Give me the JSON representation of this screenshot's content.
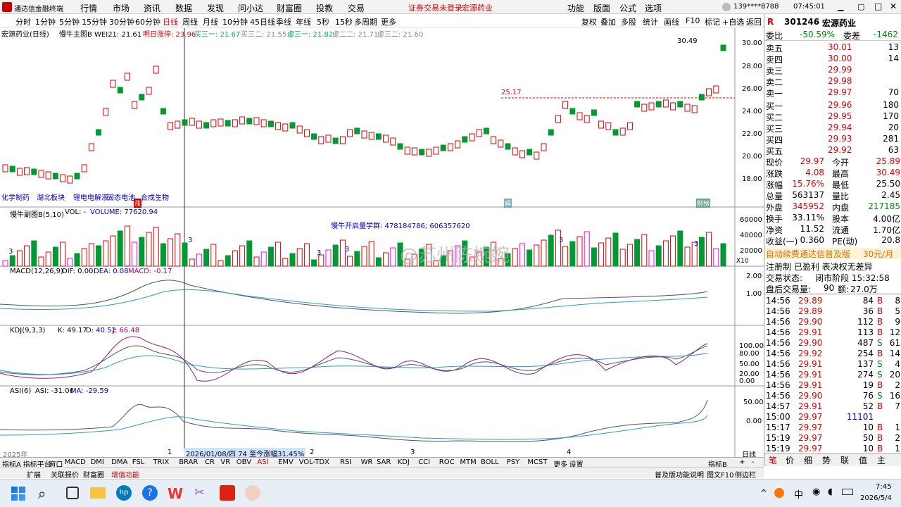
{
  "window": {
    "app_title": "通达信金融终端",
    "menus": [
      "行情",
      "市场",
      "资讯",
      "数据",
      "发现",
      "问小达",
      "财富圈",
      "投教",
      "交易"
    ],
    "notice": "证券交易未登录",
    "stock_name": "宏源药业",
    "right_menus": [
      "功能",
      "版面",
      "公式",
      "选项"
    ],
    "phone": "139****8788",
    "clock": "07:45:01"
  },
  "toolbar": {
    "periods": [
      "分时",
      "1分钟",
      "5分钟",
      "15分钟",
      "30分钟",
      "60分钟",
      "日线",
      "周线",
      "月线",
      "10分钟",
      "45日线",
      "季线",
      "年线",
      "5秒",
      "15秒",
      "多周期",
      "更多"
    ],
    "active_period": "日线",
    "tools": [
      "复权",
      "叠加",
      "多股",
      "统计",
      "画线",
      "F10",
      "标记",
      "+自选",
      "返回"
    ]
  },
  "main_chart": {
    "header_name": "宏源药业(日线)",
    "header_indicator": "慢牛主图B WEI21: 21.61",
    "header_tomorrow": "明日涨停: 23.96",
    "header_buy3": "买三一: 21.67",
    "header_sell3": "买三二: 21.55",
    "header_virt": "虚三一: 21.82",
    "header_virt2": "虚二二: 21.71",
    "header_virt3": "虚三二: 21.60",
    "high_label": "30.49",
    "dash_label": "25.17",
    "yticks": [
      "30.00",
      "28.00",
      "26.00",
      "24.00",
      "22.00",
      "20.00",
      "18.00"
    ],
    "concepts": [
      "化学制药",
      "湖北板块",
      "锂电电解液",
      "固态电池",
      "合成生物"
    ],
    "marker_dots": [
      "涨",
      "解",
      "财榜"
    ]
  },
  "volume_panel": {
    "title": "慢牛副图B(5,10)",
    "vol": "VOL: -",
    "volume": "VOLUME: 77620.94",
    "center_text": "慢牛开启量学群: 478184786; 606357620",
    "yticks": [
      "60000",
      "40000",
      "20000"
    ],
    "unit": "X10",
    "markers": [
      "3",
      "3",
      "3",
      "3",
      "3",
      "3"
    ]
  },
  "macd_panel": {
    "title": "MACD(12,26,9)",
    "dif": "DIF: 0.00",
    "dea": "DEA: 0.08",
    "macd": "MACD: -0.17",
    "yticks": [
      "2.00",
      "1.00"
    ]
  },
  "kdj_panel": {
    "title": "KDJ(9,3,3)",
    "k": "K: 49.17",
    "d": "D: 40.52",
    "j": "J: 66.48",
    "yticks": [
      "100.00",
      "80.00",
      "50.00",
      "20.00",
      "0.00"
    ]
  },
  "asi_panel": {
    "title": "ASI(6)",
    "asi": "ASI: -31.06",
    "ma": "MA: -29.59",
    "yticks": [
      "50.00",
      "0.00"
    ]
  },
  "xaxis": {
    "year": "2025年",
    "months": [
      "1",
      "2",
      "3",
      "4"
    ],
    "cursor_label": "2026/01/08/四 74 至今涨幅31.45%",
    "period_btn": "日线"
  },
  "watermark": "@苏州陈婉婉",
  "quote": {
    "code": "301246",
    "name": "宏源药业",
    "weibi_label": "委比",
    "weibi": "-50.59%",
    "weicha_label": "委差",
    "weicha": "-1462",
    "asks": [
      {
        "label": "卖五",
        "price": "30.01",
        "vol": "13"
      },
      {
        "label": "卖四",
        "price": "30.00",
        "vol": "14"
      },
      {
        "label": "卖三",
        "price": "29.99",
        "vol": ""
      },
      {
        "label": "卖二",
        "price": "29.98",
        "vol": ""
      },
      {
        "label": "卖一",
        "price": "29.97",
        "vol": "70"
      }
    ],
    "bids": [
      {
        "label": "买一",
        "price": "29.96",
        "vol": "180"
      },
      {
        "label": "买二",
        "price": "29.95",
        "vol": "170"
      },
      {
        "label": "买三",
        "price": "29.94",
        "vol": "20"
      },
      {
        "label": "买四",
        "price": "29.93",
        "vol": "281"
      },
      {
        "label": "买五",
        "price": "29.92",
        "vol": "63"
      }
    ],
    "stats": [
      {
        "l1": "现价",
        "v1": "29.97",
        "l2": "今开",
        "v2": "25.89"
      },
      {
        "l1": "涨跌",
        "v1": "4.08",
        "l2": "最高",
        "v2": "30.49"
      },
      {
        "l1": "涨幅",
        "v1": "15.76%",
        "l2": "最低",
        "v2": "25.50"
      },
      {
        "l1": "总量",
        "v1": "563137",
        "l2": "量比",
        "v2": "2.45"
      },
      {
        "l1": "外盘",
        "v1": "345952",
        "l2": "内盘",
        "v2": "217185"
      },
      {
        "l1": "换手",
        "v1": "33.11%",
        "l2": "股本",
        "v2": "4.00亿"
      },
      {
        "l1": "净资",
        "v1": "11.52",
        "l2": "流通",
        "v2": "1.70亿"
      },
      {
        "l1": "收益(一)",
        "v1": "0.360",
        "l2": "PE(动)",
        "v2": "20.8"
      }
    ],
    "promo": "自动续费通达信普及版",
    "promo_price": "30元/月",
    "reg": "注册制 已盈利 表决权无差异",
    "trade_status_label": "交易状态:",
    "trade_status": "闭市阶段 15:32:58",
    "after_label": "盘后交易量:",
    "after_vol": "90",
    "after_amt_label": "额:",
    "after_amt": "27.0万"
  },
  "ticks": [
    {
      "t": "14:56",
      "p": "29.89",
      "v": "84",
      "s": "B",
      "n": "8"
    },
    {
      "t": "14:56",
      "p": "29.89",
      "v": "36",
      "s": "B",
      "n": "5"
    },
    {
      "t": "14:56",
      "p": "29.90",
      "v": "112",
      "s": "B",
      "n": "9"
    },
    {
      "t": "14:56",
      "p": "29.91",
      "v": "113",
      "s": "B",
      "n": "12"
    },
    {
      "t": "14:56",
      "p": "29.90",
      "v": "487",
      "s": "S",
      "n": "61"
    },
    {
      "t": "14:56",
      "p": "29.92",
      "v": "254",
      "s": "B",
      "n": "14"
    },
    {
      "t": "14:56",
      "p": "29.91",
      "v": "137",
      "s": "S",
      "n": "4"
    },
    {
      "t": "14:56",
      "p": "29.91",
      "v": "274",
      "s": "S",
      "n": "20"
    },
    {
      "t": "14:56",
      "p": "29.91",
      "v": "19",
      "s": "B",
      "n": "2"
    },
    {
      "t": "14:56",
      "p": "29.90",
      "v": "76",
      "s": "S",
      "n": "16"
    },
    {
      "t": "14:57",
      "p": "29.91",
      "v": "52",
      "s": "B",
      "n": "7"
    },
    {
      "t": "15:00",
      "p": "29.97",
      "v": "11101",
      "s": "",
      "n": ""
    },
    {
      "t": "15:17",
      "p": "29.97",
      "v": "10",
      "s": "B",
      "n": "1"
    },
    {
      "t": "15:19",
      "p": "29.97",
      "v": "50",
      "s": "B",
      "n": "2"
    },
    {
      "t": "15:19",
      "p": "29.97",
      "v": "10",
      "s": "B",
      "n": "1"
    },
    {
      "t": "15:22",
      "p": "29.97",
      "v": "20",
      "s": "B",
      "n": "1"
    }
  ],
  "right_bottom_tabs": [
    "笔",
    "价",
    "细",
    "势",
    "联",
    "值",
    "主"
  ],
  "bottom_tabs": [
    "指标A",
    "指标平台",
    "窗口",
    "MACD",
    "DMI",
    "DMA",
    "FSL",
    "TRIX",
    "BRAR",
    "CR",
    "VR",
    "OBV",
    "ASI",
    "EMV",
    "VOL-TDX",
    "RSI",
    "WR",
    "SAR",
    "KDJ",
    "CCI",
    "ROC",
    "MTM",
    "BOLL",
    "PSY",
    "MCST",
    "更多",
    "设置"
  ],
  "bottom_tabs_right": [
    "指标B",
    "+",
    "-"
  ],
  "bottom_tabs2": [
    "扩展",
    "关联报价",
    "财富圈",
    "增值功能"
  ],
  "bottom_tabs2_right": [
    "普及版功能说明",
    "图文F10",
    "侧边栏"
  ],
  "taskbar": {
    "ime": "中",
    "time": "7:45",
    "date": "2026/5/4"
  }
}
